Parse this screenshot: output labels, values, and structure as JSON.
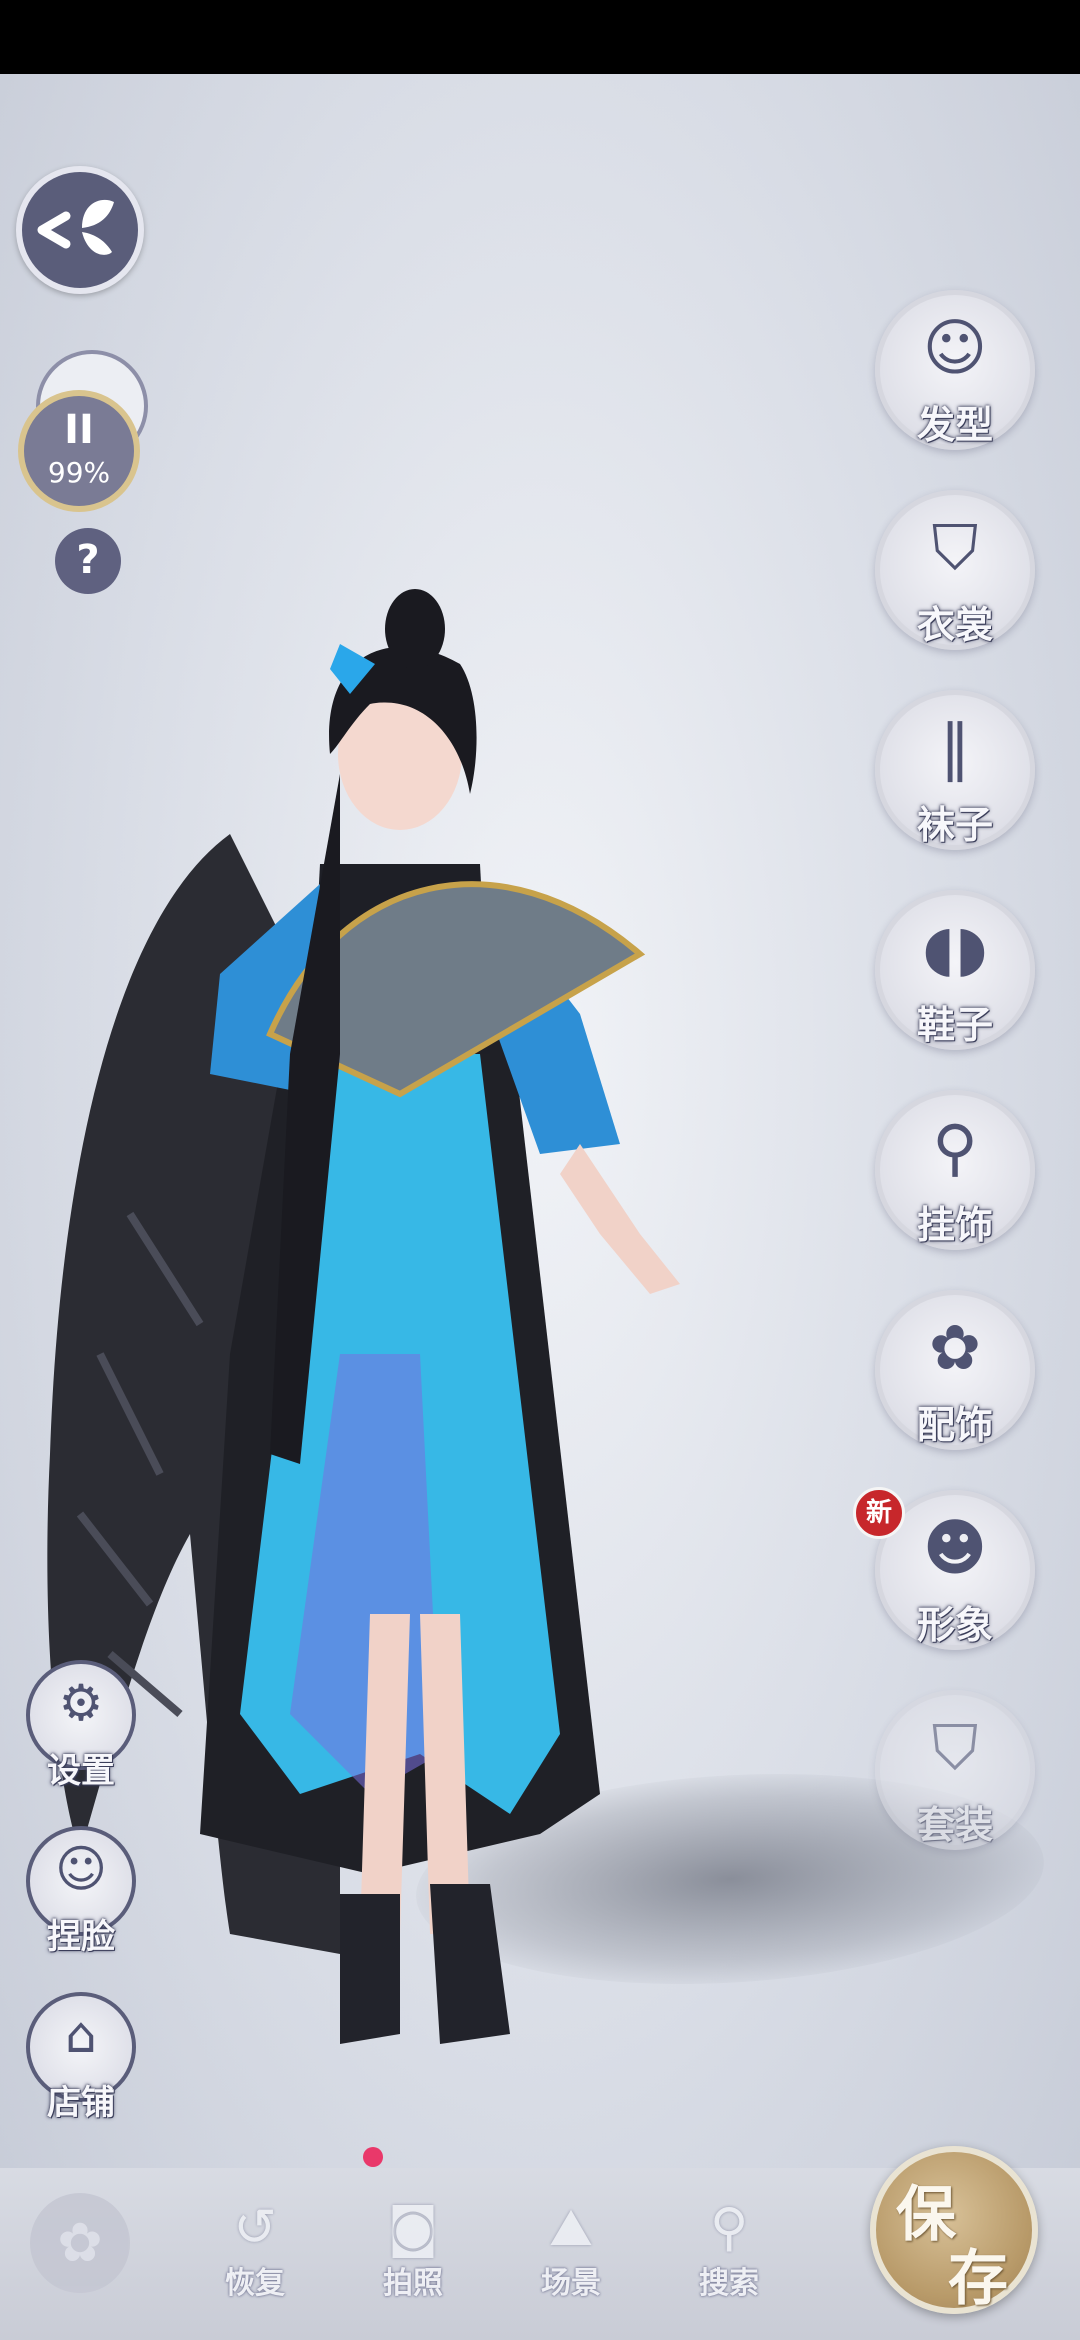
{
  "status": {
    "progress_percent": "99%",
    "pause_symbol": "II",
    "help_symbol": "?"
  },
  "right_menu": [
    {
      "label": "发型",
      "icon": "hairstyle-icon",
      "glyph": "☺"
    },
    {
      "label": "衣裳",
      "icon": "clothing-icon",
      "glyph": "⛉"
    },
    {
      "label": "袜子",
      "icon": "socks-icon",
      "glyph": "∥"
    },
    {
      "label": "鞋子",
      "icon": "shoes-icon",
      "glyph": "◖◗"
    },
    {
      "label": "挂饰",
      "icon": "pendant-icon",
      "glyph": "⚲"
    },
    {
      "label": "配饰",
      "icon": "accessory-icon",
      "glyph": "✿"
    },
    {
      "label": "形象",
      "icon": "appearance-icon",
      "glyph": "☻"
    },
    {
      "label": "套装",
      "icon": "outfit-set-icon",
      "glyph": "⛉"
    }
  ],
  "new_badge": "新",
  "left_menu": [
    {
      "label": "设置",
      "icon": "settings-icon",
      "glyph": "⚙"
    },
    {
      "label": "捏脸",
      "icon": "face-edit-icon",
      "glyph": "☺"
    },
    {
      "label": "店铺",
      "icon": "shop-icon",
      "glyph": "⌂"
    }
  ],
  "bottom_tabs": [
    {
      "label": "恢复",
      "icon": "restore-icon",
      "glyph": "↺"
    },
    {
      "label": "拍照",
      "icon": "camera-icon",
      "glyph": "◙"
    },
    {
      "label": "场景",
      "icon": "scene-icon",
      "glyph": "⛰"
    },
    {
      "label": "搜索",
      "icon": "search-icon",
      "glyph": "⚲"
    }
  ],
  "save": {
    "char1": "保",
    "char2": "存"
  },
  "colors": {
    "accent_gold": "#b89a69",
    "button_navy": "#5a5d7a",
    "badge_red": "#c7272b"
  }
}
